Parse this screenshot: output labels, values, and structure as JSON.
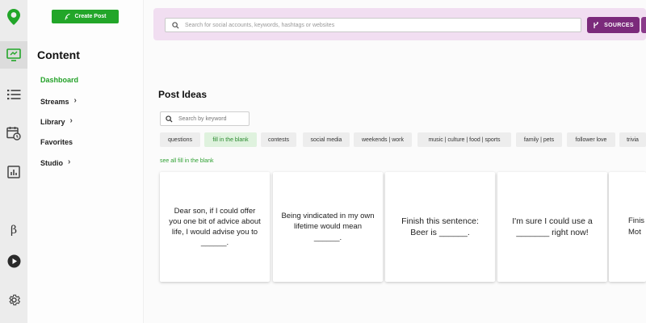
{
  "sidebar": {
    "create_post": "Create Post",
    "title": "Content",
    "items": [
      {
        "label": "Dashboard",
        "active": true,
        "has_chevron": false
      },
      {
        "label": "Streams",
        "active": false,
        "has_chevron": true
      },
      {
        "label": "Library",
        "active": false,
        "has_chevron": true
      },
      {
        "label": "Favorites",
        "active": false,
        "has_chevron": false
      },
      {
        "label": "Studio",
        "active": false,
        "has_chevron": true
      }
    ]
  },
  "rail": {
    "icons": [
      "logo-pin-icon",
      "compose-icon",
      "list-icon",
      "calendar-clock-icon",
      "bar-chart-icon",
      "beta-icon",
      "play-icon",
      "gear-icon"
    ],
    "beta_label": "β"
  },
  "topbar": {
    "search_placeholder": "Search for social accounts, keywords, hashtags or websites",
    "sources_label": "SOURCES"
  },
  "main": {
    "title": "Post Ideas",
    "keyword_placeholder": "Search by keyword",
    "tags": [
      {
        "label": "questions",
        "active": false
      },
      {
        "label": "fill in the blank",
        "active": true
      },
      {
        "label": "contests",
        "active": false
      },
      {
        "label": "social media",
        "active": false
      },
      {
        "label": "weekends | work",
        "active": false
      },
      {
        "label": "music | culture | food | sports",
        "active": false
      },
      {
        "label": "family | pets",
        "active": false
      },
      {
        "label": "follower love",
        "active": false
      },
      {
        "label": "trivia",
        "active": false
      }
    ],
    "see_all": "see all fill in the blank",
    "cards": [
      {
        "text": "Dear son, if I could offer you one bit of advice about life, I would advise you to ______."
      },
      {
        "text": "Being vindicated in my own lifetime would mean ______."
      },
      {
        "text": "Finish this sentence: Beer is ______."
      },
      {
        "text": "I'm sure I could use a _______ right now!"
      },
      {
        "text": "Finis\nMot"
      }
    ]
  },
  "colors": {
    "brand_green": "#22a629",
    "topbar_bg": "#f1def1",
    "sources_purple": "#7b2a7b"
  }
}
